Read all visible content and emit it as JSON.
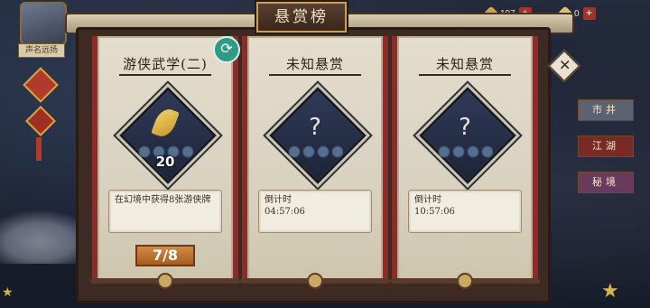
{
  "header": {
    "title": "悬赏榜"
  },
  "player": {
    "tag": "声名远扬"
  },
  "currency": [
    {
      "icon": "gold-coin-icon",
      "amount": "197"
    },
    {
      "icon": "ingot-icon",
      "amount": "0"
    }
  ],
  "cards": [
    {
      "title": "游侠武学(二)",
      "icon": "golden-leaf-icon",
      "count": "20",
      "description": "在幻境中获得8张游侠牌",
      "progress": "7/8"
    },
    {
      "title": "未知悬赏",
      "icon": "question-mark-icon",
      "symbol": "?",
      "countdown_label": "倒计时",
      "countdown": "04:57:06"
    },
    {
      "title": "未知悬赏",
      "icon": "question-mark-icon",
      "symbol": "?",
      "countdown_label": "倒计时",
      "countdown": "10:57:06"
    }
  ],
  "side_tabs": [
    "市井",
    "江湖",
    "秘境"
  ],
  "colors": {
    "accent_red": "#8a2c2a",
    "paper": "#e4ddcd",
    "gold": "#c9a158",
    "refresh": "#2f9b84"
  }
}
